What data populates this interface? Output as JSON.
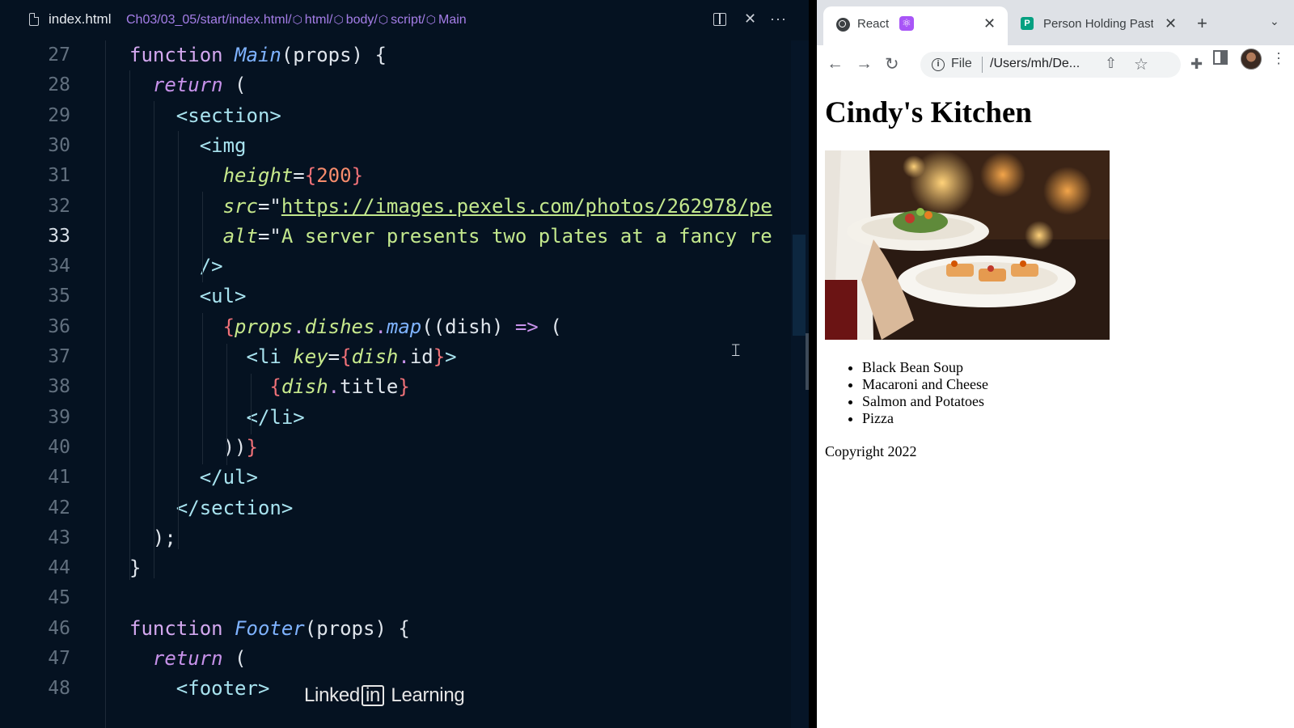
{
  "editor": {
    "filename": "index.html",
    "breadcrumb": [
      {
        "label": "Ch03/03_05/start/index.html/",
        "icon": "none"
      },
      {
        "label": "html/",
        "icon": "cube-icon"
      },
      {
        "label": "body/",
        "icon": "cube-icon"
      },
      {
        "label": "script/",
        "icon": "cube-icon"
      },
      {
        "label": "Main",
        "icon": "cube-icon"
      }
    ],
    "active_line": 33,
    "lines": [
      {
        "n": 27,
        "tokens": [
          [
            "kw",
            "function "
          ],
          [
            "fn",
            "Main"
          ],
          [
            "",
            "(props) {"
          ]
        ]
      },
      {
        "n": 28,
        "tokens": [
          [
            "",
            "  "
          ],
          [
            "ret",
            "return"
          ],
          [
            "",
            " ("
          ]
        ]
      },
      {
        "n": 29,
        "tokens": [
          [
            "",
            "    "
          ],
          [
            "tag",
            "<section>"
          ]
        ]
      },
      {
        "n": 30,
        "tokens": [
          [
            "",
            "      "
          ],
          [
            "tag",
            "<img"
          ]
        ]
      },
      {
        "n": 31,
        "tokens": [
          [
            "",
            "        "
          ],
          [
            "attr",
            "height"
          ],
          [
            "",
            "="
          ],
          [
            "br",
            "{"
          ],
          [
            "num",
            "200"
          ],
          [
            "br",
            "}"
          ]
        ]
      },
      {
        "n": 32,
        "tokens": [
          [
            "",
            "        "
          ],
          [
            "attr",
            "src"
          ],
          [
            "",
            "=\""
          ],
          [
            "url",
            "https://images.pexels.com/photos/262978/pe"
          ]
        ]
      },
      {
        "n": 33,
        "tokens": [
          [
            "",
            "        "
          ],
          [
            "attr",
            "alt"
          ],
          [
            "",
            "=\""
          ],
          [
            "str",
            "A server presents two plates at a fancy re"
          ]
        ]
      },
      {
        "n": 34,
        "tokens": [
          [
            "",
            "      "
          ],
          [
            "tag",
            "/>"
          ]
        ]
      },
      {
        "n": 35,
        "tokens": [
          [
            "",
            "      "
          ],
          [
            "tag",
            "<ul>"
          ]
        ]
      },
      {
        "n": 36,
        "tokens": [
          [
            "",
            "        "
          ],
          [
            "br",
            "{"
          ],
          [
            "it",
            "props"
          ],
          [
            "",
            ""
          ],
          [
            "op",
            "."
          ],
          [
            "prop",
            "dishes"
          ],
          [
            "op",
            "."
          ],
          [
            "fn",
            "map"
          ],
          [
            "",
            "((dish) "
          ],
          [
            "op",
            "=>"
          ],
          [
            "",
            " ("
          ]
        ]
      },
      {
        "n": 37,
        "tokens": [
          [
            "",
            "          "
          ],
          [
            "tag",
            "<li "
          ],
          [
            "attr",
            "key"
          ],
          [
            "",
            "="
          ],
          [
            "br",
            "{"
          ],
          [
            "it",
            "dish"
          ],
          [
            "op",
            "."
          ],
          [
            "",
            "id"
          ],
          [
            "br",
            "}"
          ],
          [
            "tag",
            ">"
          ]
        ]
      },
      {
        "n": 38,
        "tokens": [
          [
            "",
            "            "
          ],
          [
            "br",
            "{"
          ],
          [
            "it",
            "dish"
          ],
          [
            "op",
            "."
          ],
          [
            "",
            "title"
          ],
          [
            "br",
            "}"
          ]
        ]
      },
      {
        "n": 39,
        "tokens": [
          [
            "",
            "          "
          ],
          [
            "tag",
            "</li>"
          ]
        ]
      },
      {
        "n": 40,
        "tokens": [
          [
            "",
            "        "
          ],
          [
            "",
            "))"
          ],
          [
            "br",
            "}"
          ]
        ]
      },
      {
        "n": 41,
        "tokens": [
          [
            "",
            "      "
          ],
          [
            "tag",
            "</ul>"
          ]
        ]
      },
      {
        "n": 42,
        "tokens": [
          [
            "",
            "    "
          ],
          [
            "tag",
            "</section>"
          ]
        ]
      },
      {
        "n": 43,
        "tokens": [
          [
            "",
            "  "
          ],
          [
            "",
            ");"
          ]
        ]
      },
      {
        "n": 44,
        "tokens": [
          [
            "",
            "}"
          ]
        ]
      },
      {
        "n": 45,
        "tokens": []
      },
      {
        "n": 46,
        "tokens": [
          [
            "kw",
            "function "
          ],
          [
            "fn",
            "Footer"
          ],
          [
            "",
            "(props) {"
          ]
        ]
      },
      {
        "n": 47,
        "tokens": [
          [
            "",
            "  "
          ],
          [
            "ret",
            "return"
          ],
          [
            "",
            " ("
          ]
        ]
      },
      {
        "n": 48,
        "tokens": [
          [
            "",
            "    "
          ],
          [
            "tag",
            "<footer>"
          ]
        ]
      }
    ]
  },
  "browser": {
    "tabs": [
      {
        "title": "React",
        "active": true
      },
      {
        "title": "Person Holding Pastr",
        "active": false
      }
    ],
    "url_scheme": "File",
    "url_path": "/Users/mh/De...",
    "page": {
      "title": "Cindy's Kitchen",
      "image_alt": "A server presents two plates at a fancy restaurant",
      "dishes": [
        "Black Bean Soup",
        "Macaroni and Cheese",
        "Salmon and Potatoes",
        "Pizza"
      ],
      "footer": "Copyright 2022"
    }
  },
  "watermark": {
    "left": "Linked",
    "badge": "in",
    "right": " Learning"
  }
}
